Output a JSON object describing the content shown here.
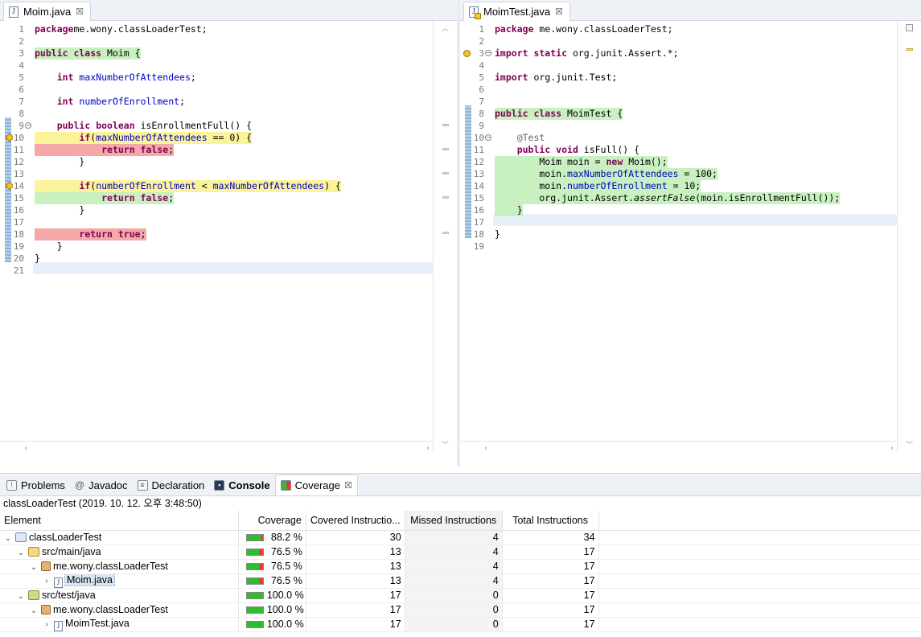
{
  "left_editor": {
    "tab_label": "Moim.java",
    "tab_close": "☒",
    "lines": [
      {
        "n": "1",
        "segs": [
          [
            "kw",
            "package"
          ],
          [
            "",
            "me.wony.classLoaderTest;"
          ]
        ]
      },
      {
        "n": "2",
        "segs": []
      },
      {
        "n": "3",
        "hl": "g",
        "segs": [
          [
            "kw",
            "public class"
          ],
          [
            "",
            " Moim {"
          ]
        ]
      },
      {
        "n": "4",
        "segs": []
      },
      {
        "n": "5",
        "segs": [
          [
            "",
            "    "
          ],
          [
            "kw",
            "int"
          ],
          [
            "",
            " "
          ],
          [
            "fld",
            "maxNumberOfAttendees"
          ],
          [
            "",
            ";"
          ]
        ]
      },
      {
        "n": "6",
        "segs": []
      },
      {
        "n": "7",
        "segs": [
          [
            "",
            "    "
          ],
          [
            "kw",
            "int"
          ],
          [
            "",
            " "
          ],
          [
            "fld",
            "numberOfEnrollment"
          ],
          [
            "",
            ";"
          ]
        ]
      },
      {
        "n": "8",
        "segs": []
      },
      {
        "n": "9",
        "segs": [
          [
            "",
            "    "
          ],
          [
            "kw",
            "public"
          ],
          [
            "",
            " "
          ],
          [
            "kw",
            "boolean"
          ],
          [
            "",
            " isEnrollmentFull() {"
          ]
        ]
      },
      {
        "n": "10",
        "hl": "y",
        "segs": [
          [
            "",
            "        "
          ],
          [
            "kw",
            "if"
          ],
          [
            "",
            "("
          ],
          [
            "fld",
            "maxNumberOfAttendees"
          ],
          [
            "",
            " == 0) {"
          ]
        ]
      },
      {
        "n": "11",
        "hl": "r",
        "segs": [
          [
            "",
            "            "
          ],
          [
            "kw",
            "return false"
          ],
          [
            "",
            ";"
          ]
        ]
      },
      {
        "n": "12",
        "segs": [
          [
            "",
            "        }"
          ]
        ]
      },
      {
        "n": "13",
        "segs": []
      },
      {
        "n": "14",
        "hl": "y",
        "segs": [
          [
            "",
            "        "
          ],
          [
            "kw",
            "if"
          ],
          [
            "",
            "("
          ],
          [
            "fld",
            "numberOfEnrollment"
          ],
          [
            "",
            " < "
          ],
          [
            "fld",
            "maxNumberOfAttendees"
          ],
          [
            "",
            ") {"
          ]
        ]
      },
      {
        "n": "15",
        "hl": "g",
        "segs": [
          [
            "",
            "            "
          ],
          [
            "kw",
            "return false"
          ],
          [
            "",
            ";"
          ]
        ]
      },
      {
        "n": "16",
        "segs": [
          [
            "",
            "        }"
          ]
        ]
      },
      {
        "n": "17",
        "segs": []
      },
      {
        "n": "18",
        "hl": "r",
        "segs": [
          [
            "",
            "        "
          ],
          [
            "kw",
            "return true"
          ],
          [
            "",
            ";"
          ]
        ]
      },
      {
        "n": "19",
        "segs": [
          [
            "",
            "    }"
          ]
        ]
      },
      {
        "n": "20",
        "segs": [
          [
            "",
            "}"
          ]
        ]
      },
      {
        "n": "21",
        "segs": []
      }
    ]
  },
  "right_editor": {
    "tab_label": "MoimTest.java",
    "tab_close": "☒",
    "lines": [
      {
        "n": "1",
        "segs": [
          [
            "kw",
            "package"
          ],
          [
            "",
            " me.wony.classLoaderTest;"
          ]
        ]
      },
      {
        "n": "2",
        "segs": []
      },
      {
        "n": "3",
        "segs": [
          [
            "kw",
            "import static"
          ],
          [
            "",
            " org.junit.Assert.*;"
          ]
        ]
      },
      {
        "n": "4",
        "segs": []
      },
      {
        "n": "5",
        "segs": [
          [
            "kw",
            "import"
          ],
          [
            "",
            " org.junit.Test;"
          ]
        ]
      },
      {
        "n": "6",
        "segs": []
      },
      {
        "n": "7",
        "segs": []
      },
      {
        "n": "8",
        "hl": "g",
        "segs": [
          [
            "kw",
            "public class"
          ],
          [
            "",
            " MoimTest {"
          ]
        ]
      },
      {
        "n": "9",
        "segs": []
      },
      {
        "n": "10",
        "segs": [
          [
            "",
            "    "
          ],
          [
            "ann",
            "@Test"
          ]
        ]
      },
      {
        "n": "11",
        "segs": [
          [
            "",
            "    "
          ],
          [
            "kw",
            "public void"
          ],
          [
            "",
            " isFull() {"
          ]
        ]
      },
      {
        "n": "12",
        "hl": "g",
        "segs": [
          [
            "",
            "        Moim moin = "
          ],
          [
            "kw",
            "new"
          ],
          [
            "",
            " Moim();"
          ]
        ]
      },
      {
        "n": "13",
        "hl": "g",
        "segs": [
          [
            "",
            "        moin."
          ],
          [
            "fld",
            "maxNumberOfAttendees"
          ],
          [
            "",
            " = 100;"
          ]
        ]
      },
      {
        "n": "14",
        "hl": "g",
        "segs": [
          [
            "",
            "        moin."
          ],
          [
            "fld",
            "numberOfEnrollment"
          ],
          [
            "",
            " = 10;"
          ]
        ]
      },
      {
        "n": "15",
        "hl": "g",
        "segs": [
          [
            "",
            "        org.junit.Assert."
          ],
          [
            "itl",
            "assertFalse"
          ],
          [
            "",
            "(moin.isEnrollmentFull());"
          ]
        ]
      },
      {
        "n": "16",
        "hl": "g",
        "segs": [
          [
            "",
            "    }"
          ]
        ]
      },
      {
        "n": "17",
        "segs": []
      },
      {
        "n": "18",
        "segs": [
          [
            "",
            "}"
          ]
        ]
      },
      {
        "n": "19",
        "segs": []
      }
    ]
  },
  "bottom_tabs": {
    "problems": "Problems",
    "javadoc": "Javadoc",
    "declaration": "Declaration",
    "console": "Console",
    "coverage": "Coverage",
    "close": "☒"
  },
  "coverage": {
    "session": "classLoaderTest (2019. 10. 12. 오후 3:48:50)",
    "headers": {
      "element": "Element",
      "coverage": "Coverage",
      "covered": "Covered Instructio...",
      "missed": "Missed Instructions",
      "total": "Total Instructions"
    },
    "rows": [
      {
        "name": "classLoaderTest",
        "type": "proj",
        "indent": 0,
        "twisty": "⌄",
        "coverage": "88.2 %",
        "covered": "30",
        "missed": "4",
        "total": "34",
        "fraction": 0.882
      },
      {
        "name": "src/main/java",
        "type": "srcf",
        "indent": 1,
        "twisty": "⌄",
        "coverage": "76.5 %",
        "covered": "13",
        "missed": "4",
        "total": "17",
        "fraction": 0.765
      },
      {
        "name": "me.wony.classLoaderTest",
        "type": "pkg",
        "indent": 2,
        "twisty": "⌄",
        "coverage": "76.5 %",
        "covered": "13",
        "missed": "4",
        "total": "17",
        "fraction": 0.765
      },
      {
        "name": "Moim.java",
        "type": "jf",
        "indent": 3,
        "twisty": "›",
        "coverage": "76.5 %",
        "covered": "13",
        "missed": "4",
        "total": "17",
        "fraction": 0.765,
        "selected": true
      },
      {
        "name": "src/test/java",
        "type": "srcf test",
        "indent": 1,
        "twisty": "⌄",
        "coverage": "100.0 %",
        "covered": "17",
        "missed": "0",
        "total": "17",
        "fraction": 1.0
      },
      {
        "name": "me.wony.classLoaderTest",
        "type": "pkg",
        "indent": 2,
        "twisty": "⌄",
        "coverage": "100.0 %",
        "covered": "17",
        "missed": "0",
        "total": "17",
        "fraction": 1.0
      },
      {
        "name": "MoimTest.java",
        "type": "jf",
        "indent": 3,
        "twisty": "›",
        "coverage": "100.0 %",
        "covered": "17",
        "missed": "0",
        "total": "17",
        "fraction": 1.0
      }
    ],
    "colors": {
      "covered": "#2ebd2e",
      "missed": "#e83a3a"
    }
  }
}
